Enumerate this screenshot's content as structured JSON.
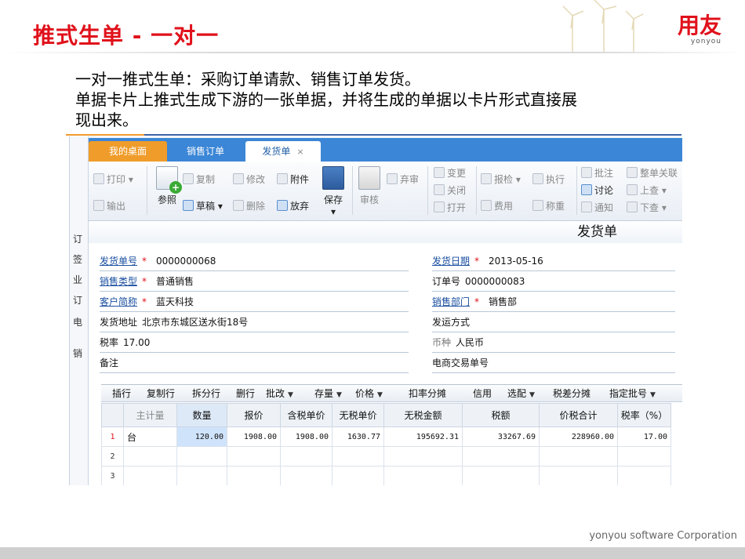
{
  "slide": {
    "title": "推式生单 - 一对一",
    "logo_main": "用友",
    "logo_sub": "yonyou",
    "desc_line1": "一对一推式生单：采购订单请款、销售订单发货。",
    "desc_line2": "单据卡片上推式生成下游的一张单据，并将生成的单据以卡片形式直接展",
    "desc_line3": "现出来。",
    "footer": "yonyou software Corporation"
  },
  "app": {
    "left_strip": [
      "订",
      "签",
      "业",
      "订",
      "电",
      "销"
    ],
    "tabs": {
      "home": "我的桌面",
      "sales_order": "销售订单",
      "delivery": "发货单",
      "close": "×"
    },
    "toolbar": {
      "print": "打印",
      "export": "输出",
      "reference": "参照",
      "copy": "复制",
      "draft": "草稿",
      "modify": "修改",
      "delete": "删除",
      "attach": "附件",
      "discard": "放弃",
      "save": "保存",
      "review": "审核",
      "abandon": "弃审",
      "change": "变更",
      "close": "关闭",
      "open": "打开",
      "report_check": "报检",
      "expense": "费用",
      "execute": "执行",
      "weigh": "称重",
      "annotate": "批注",
      "discuss": "讨论",
      "notify": "通知",
      "whole_link": "整单关联",
      "prev": "上查",
      "next": "下查"
    },
    "form": {
      "title": "发货单",
      "delivery_no_label": "发货单号",
      "delivery_no": "0000000068",
      "delivery_date_label": "发货日期",
      "delivery_date": "2013-05-16",
      "sales_type_label": "销售类型",
      "sales_type": "普通销售",
      "order_no_label": "订单号",
      "order_no": "0000000083",
      "customer_label": "客户简称",
      "customer": "蓝天科技",
      "dept_label": "销售部门",
      "dept": "销售部",
      "address_label": "发货地址",
      "address": "北京市东城区送水街18号",
      "ship_method_label": "发运方式",
      "ship_method": "",
      "tax_rate_label": "税率",
      "tax_rate": "17.00",
      "currency_label": "币种",
      "currency": "人民币",
      "remark_label": "备注",
      "remark": "",
      "ecom_label": "电商交易单号",
      "ecom": ""
    },
    "grid_toolbar": {
      "insert": "插行",
      "copy_row": "复制行",
      "split_row": "拆分行",
      "delete_row": "删行",
      "batch_edit": "批改",
      "stock": "存量",
      "price": "价格",
      "discount": "扣率分摊",
      "credit": "信用",
      "match": "选配",
      "tax_diff": "税差分摊",
      "batch_no": "指定批号"
    },
    "grid": {
      "headers": [
        "主计量",
        "数量",
        "报价",
        "含税单价",
        "无税单价",
        "无税金额",
        "税额",
        "价税合计",
        "税率（%）"
      ],
      "rows": [
        {
          "n": "1",
          "unit": "台",
          "qty": "120.00",
          "quote": "1908.00",
          "tax_price": "1908.00",
          "net_price": "1630.77",
          "net_amount": "195692.31",
          "tax": "33267.69",
          "total": "228960.00",
          "rate": "17.00"
        },
        {
          "n": "2"
        },
        {
          "n": "3"
        }
      ]
    }
  }
}
